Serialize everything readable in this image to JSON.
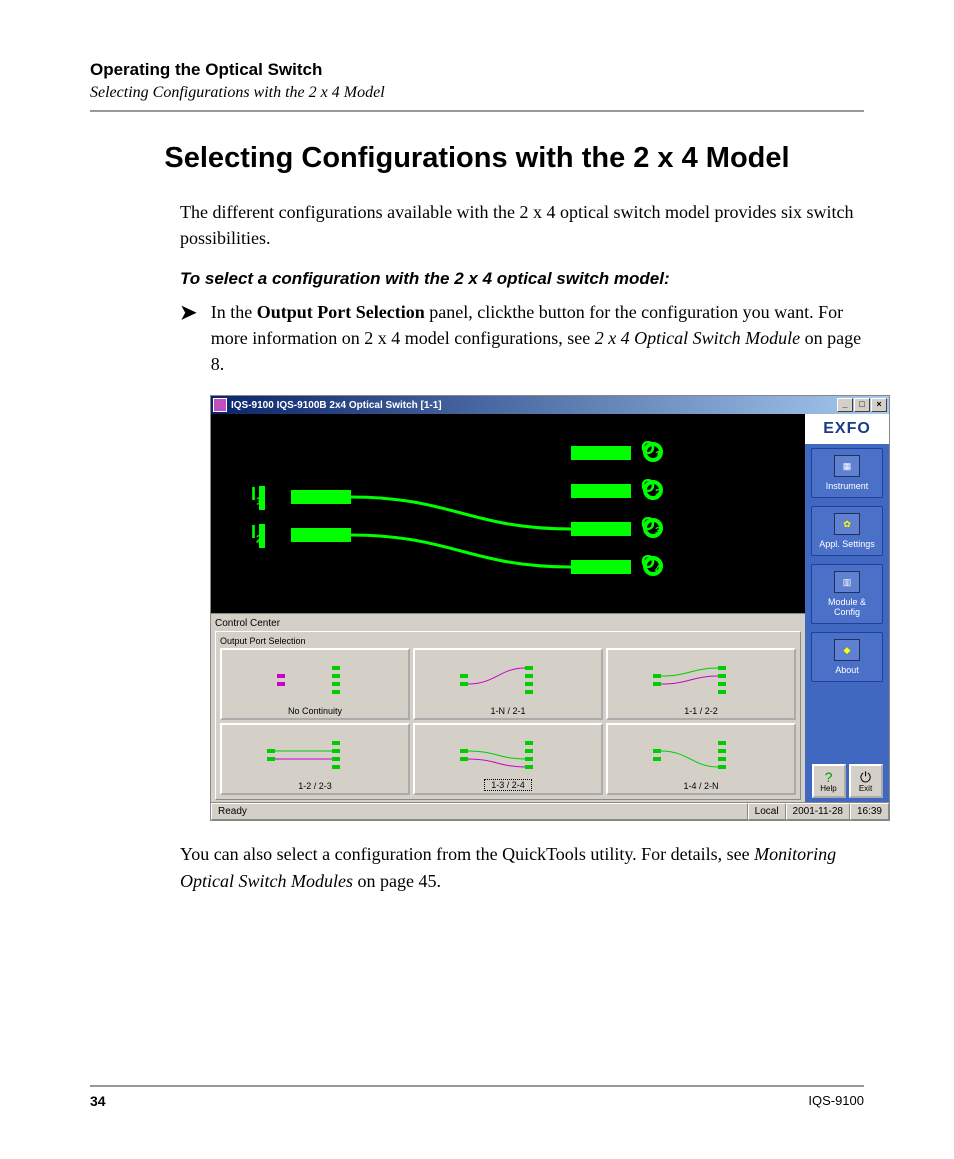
{
  "header": {
    "section": "Operating the Optical Switch",
    "subsection": "Selecting Configurations with the 2 x 4 Model"
  },
  "title": "Selecting Configurations with the 2 x 4 Model",
  "intro": "The different configurations available with the 2 x 4 optical switch model provides six switch possibilities.",
  "step_heading": "To select a configuration with the 2 x 4 optical switch model:",
  "step_pre": "In the ",
  "step_bold": "Output Port Selection",
  "step_mid": " panel, clickthe button for the configuration you want. For more information on 2 x 4 model configurations, see ",
  "step_ital": "2 x 4 Optical Switch Module",
  "step_post": " on page 8.",
  "outro_pre": "You can also select a configuration from the QuickTools utility. For details, see ",
  "outro_ital": "Monitoring Optical Switch Modules",
  "outro_post": " on page 45.",
  "footer": {
    "page": "34",
    "model": "IQS-9100"
  },
  "app": {
    "title": "IQS-9100 IQS-9100B 2x4 Optical Switch [1-1]",
    "brand": "EXFO",
    "inputs": [
      "1",
      "2"
    ],
    "outputs": [
      "1",
      "2",
      "3",
      "4"
    ],
    "control_center": "Control Center",
    "output_port_selection": "Output Port Selection",
    "configs": [
      "No Continuity",
      "1-N / 2-1",
      "1-1 / 2-2",
      "1-2 / 2-3",
      "1-3 / 2-4",
      "1-4 / 2-N"
    ],
    "selected_config": 4,
    "sidebar": [
      "Instrument",
      "Appl. Settings",
      "Module & Config",
      "About"
    ],
    "help": "Help",
    "exit": "Exit",
    "status": {
      "ready": "Ready",
      "local": "Local",
      "date": "2001-11-28",
      "time": "16:39"
    }
  }
}
